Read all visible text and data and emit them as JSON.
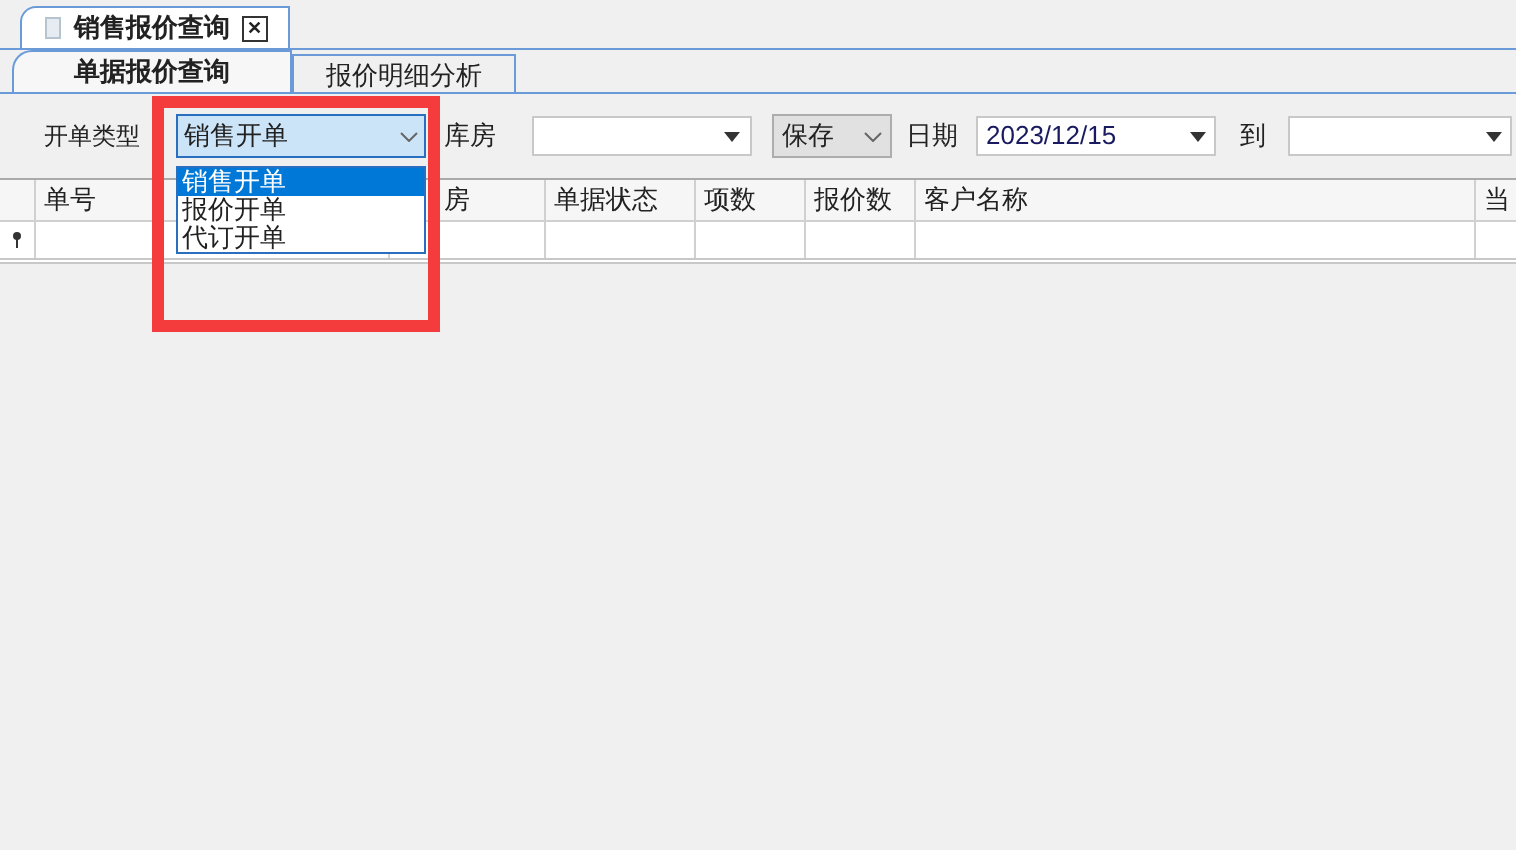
{
  "document_tab": {
    "title": "销售报价查询",
    "close": "✕"
  },
  "tabs": [
    {
      "label": "单据报价查询",
      "selected": true
    },
    {
      "label": "报价明细分析",
      "selected": false
    }
  ],
  "filters": {
    "order_type": {
      "label": "开单类型",
      "value": "销售开单",
      "expanded": true,
      "options": [
        {
          "label": "销售开单",
          "selected": true
        },
        {
          "label": "报价开单",
          "selected": false
        },
        {
          "label": "代订开单",
          "selected": false
        }
      ]
    },
    "warehouse": {
      "label": "库房"
    },
    "status": {
      "value": "保存"
    },
    "date": {
      "label": "日期",
      "value": "2023/12/15"
    },
    "to": {
      "label": "到"
    }
  },
  "table": {
    "columns": [
      {
        "label": "单号"
      },
      {
        "label": "房"
      },
      {
        "label": "单据状态"
      },
      {
        "label": "项数"
      },
      {
        "label": "报价数"
      },
      {
        "label": "客户名称"
      },
      {
        "label": "当"
      }
    ]
  },
  "highlight": {
    "color": "#f53c3c"
  }
}
